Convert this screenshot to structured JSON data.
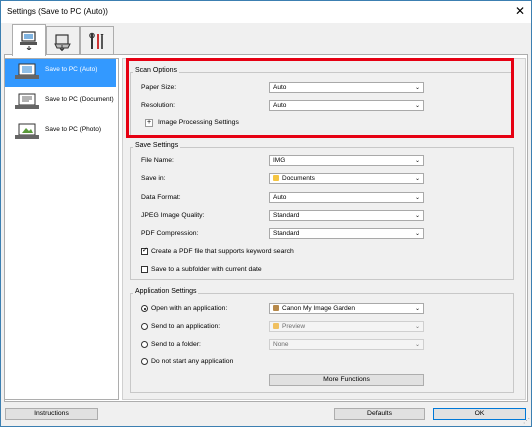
{
  "window": {
    "title": "Settings (Save to PC (Auto))",
    "close_glyph": "✕"
  },
  "tabs": [
    {
      "name": "scan-from-computer-tab",
      "icon": "computer-arrow-icon",
      "active": true
    },
    {
      "name": "scan-from-panel-tab",
      "icon": "scanner-icon",
      "active": false
    },
    {
      "name": "general-settings-tab",
      "icon": "tools-icon",
      "active": false
    }
  ],
  "sidebar": {
    "items": [
      {
        "label": "Save to PC (Auto)",
        "selected": true,
        "icon": "auto-scan-icon"
      },
      {
        "label": "Save to PC (Document)",
        "selected": false,
        "icon": "document-scan-icon"
      },
      {
        "label": "Save to PC (Photo)",
        "selected": false,
        "icon": "photo-scan-icon"
      }
    ]
  },
  "scan_options": {
    "title": "Scan Options",
    "paper_size_label": "Paper Size:",
    "paper_size_value": "Auto",
    "resolution_label": "Resolution:",
    "resolution_value": "Auto",
    "image_processing_label": "Image Processing Settings",
    "expand_glyph": "+"
  },
  "save_settings": {
    "title": "Save Settings",
    "file_name_label": "File Name:",
    "file_name_value": "IMG",
    "save_in_label": "Save in:",
    "save_in_value": "Documents",
    "data_format_label": "Data Format:",
    "data_format_value": "Auto",
    "jpeg_quality_label": "JPEG Image Quality:",
    "jpeg_quality_value": "Standard",
    "pdf_compression_label": "PDF Compression:",
    "pdf_compression_value": "Standard",
    "keyword_pdf_label": "Create a PDF file that supports keyword search",
    "keyword_pdf_checked": true,
    "subfolder_label": "Save to a subfolder with current date",
    "subfolder_checked": false
  },
  "application_settings": {
    "title": "Application Settings",
    "open_with_label": "Open with an application:",
    "open_with_value": "Canon My Image Garden",
    "send_to_app_label": "Send to an application:",
    "send_to_app_value": "Preview",
    "send_to_folder_label": "Send to a folder:",
    "send_to_folder_value": "None",
    "no_app_label": "Do not start any application",
    "selected_option": "open_with",
    "more_functions_label": "More Functions"
  },
  "footer": {
    "instructions_label": "Instructions",
    "defaults_label": "Defaults",
    "ok_label": "OK"
  },
  "dropdown_arrow": "⌄",
  "colors": {
    "selection": "#3399ff",
    "highlight_box": "#e60012",
    "window_border": "#3c7fb1"
  }
}
